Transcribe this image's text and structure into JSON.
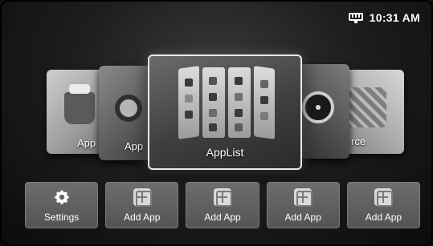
{
  "status": {
    "time": "10:31 AM",
    "network_icon": "ethernet-icon"
  },
  "carousel": {
    "cards": [
      {
        "label": "App",
        "icon": "apps-icon"
      },
      {
        "label": "App",
        "icon": "gear-icon"
      },
      {
        "label": "AppList",
        "icon": "app-list-icon",
        "selected": true
      },
      {
        "label": "",
        "icon": "music-disc-icon"
      },
      {
        "label": "rce",
        "icon": "source-cables-icon"
      }
    ]
  },
  "tiles": [
    {
      "label": "Settings",
      "icon": "settings-gear-icon"
    },
    {
      "label": "Add App",
      "icon": "add-app-icon"
    },
    {
      "label": "Add App",
      "icon": "add-app-icon"
    },
    {
      "label": "Add App",
      "icon": "add-app-icon"
    },
    {
      "label": "Add App",
      "icon": "add-app-icon"
    }
  ]
}
